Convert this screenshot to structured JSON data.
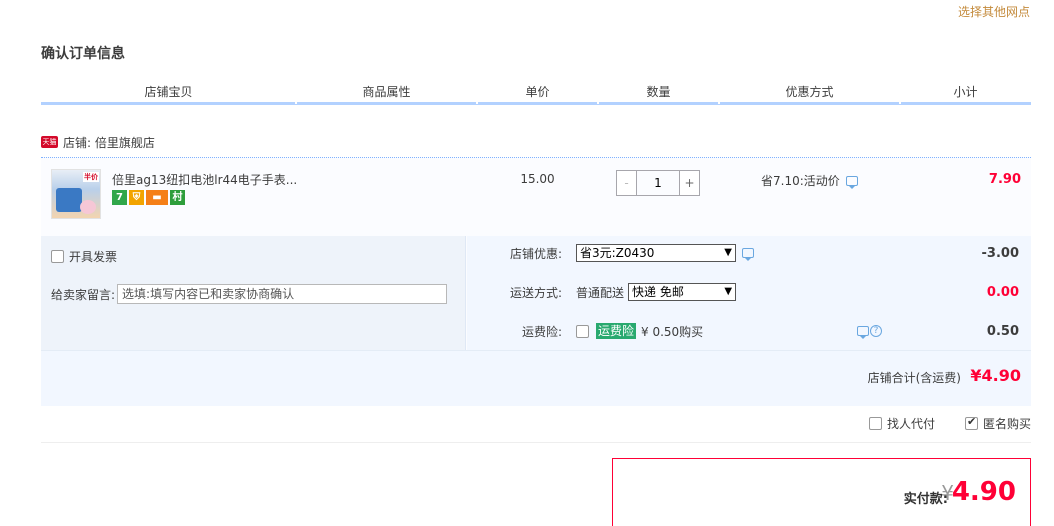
{
  "top_link": "选择其他网点",
  "page_title": "确认订单信息",
  "columns": [
    "店铺宝贝",
    "商品属性",
    "单价",
    "数量",
    "优惠方式",
    "小计"
  ],
  "shop": {
    "icon_text": "天猫",
    "label": "店铺: 倍里旗舰店"
  },
  "item": {
    "thumb_badge": "半价",
    "title": "倍里ag13纽扣电池lr44电子手表...",
    "service_icons": [
      {
        "name": "seven-day-return-icon",
        "text": "7"
      },
      {
        "name": "shield-guarantee-icon",
        "text": "⛨"
      },
      {
        "name": "credit-card-icon",
        "text": "▬"
      },
      {
        "name": "village-taobao-icon",
        "text": "村"
      }
    ],
    "price": "15.00",
    "quantity": "1",
    "minus": "-",
    "plus": "+",
    "promo": "省7.10:活动价",
    "subtotal": "7.90"
  },
  "invoice_label": "开具发票",
  "memo": {
    "label": "给卖家留言:",
    "placeholder": "选填:填写内容已和卖家协商确认"
  },
  "coupon": {
    "label": "店铺优惠:",
    "selected": "省3元:Z0430",
    "value": "-3.00"
  },
  "shipping": {
    "label": "运送方式:",
    "method": "普通配送",
    "selected": "快递 免邮",
    "value": "0.00"
  },
  "insurance": {
    "label": "运费险:",
    "tag": "运费险",
    "price": "¥ 0.50购买",
    "value": "0.50"
  },
  "shop_total": {
    "label": "店铺合计(含运费)",
    "value": "¥4.90"
  },
  "pay_for_me": "找人代付",
  "anonymous": "匿名购买",
  "payment": {
    "label": "实付款:",
    "currency": "¥",
    "amount": "4.90"
  },
  "colors": {
    "accent_red": "#ff0036",
    "header_blue": "#b2d1ff",
    "link_brown": "#c48b3c"
  }
}
